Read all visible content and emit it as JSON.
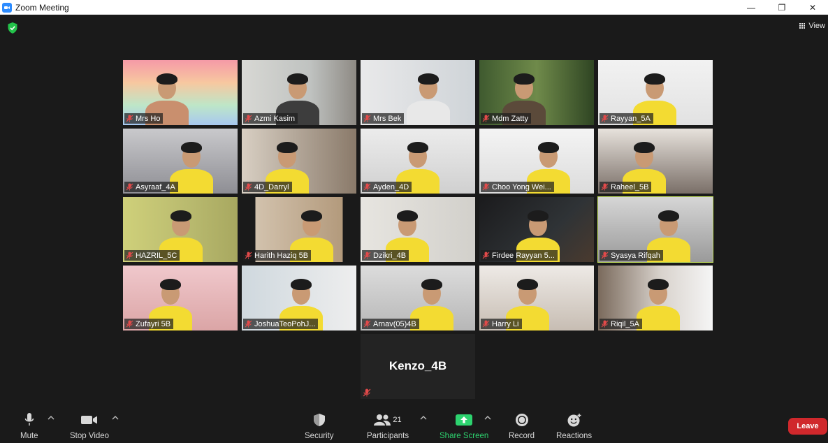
{
  "window": {
    "title": "Zoom Meeting",
    "minimize": "—",
    "maximize": "❐",
    "close": "✕"
  },
  "header": {
    "view_label": "View"
  },
  "participants_grid": [
    {
      "name": "Mrs Ho"
    },
    {
      "name": "Azmi Kasim"
    },
    {
      "name": "Mrs Bek"
    },
    {
      "name": "Mdm Zatty"
    },
    {
      "name": "Rayyan_5A"
    },
    {
      "name": "Asyraaf_4A"
    },
    {
      "name": "4D_Darryl"
    },
    {
      "name": "Ayden_4D"
    },
    {
      "name": "Choo Yong Wei..."
    },
    {
      "name": "Raheel_5B"
    },
    {
      "name": "HAZRIL_5C"
    },
    {
      "name": "Harith Haziq 5B"
    },
    {
      "name": "Dzikri_4B"
    },
    {
      "name": "Firdee Rayyan 5..."
    },
    {
      "name": "Syasya Rifqah",
      "active_speaker": true
    },
    {
      "name": "Zufayri 5B"
    },
    {
      "name": "JoshuaTeoPohJ..."
    },
    {
      "name": "Arnav(05)4B"
    },
    {
      "name": "Harry Li"
    },
    {
      "name": "Riqil_5A"
    },
    {
      "name": "Kenzo_4B",
      "video_off": true
    }
  ],
  "toolbar": {
    "mute": "Mute",
    "stop_video": "Stop Video",
    "security": "Security",
    "participants": "Participants",
    "participants_count": "21",
    "share_screen": "Share Screen",
    "record": "Record",
    "reactions": "Reactions",
    "leave": "Leave"
  },
  "colors": {
    "accent_share": "#2dd36f",
    "leave": "#d0282c",
    "active_speaker_border": "#c4e35e",
    "shirt": "#f3db32"
  }
}
